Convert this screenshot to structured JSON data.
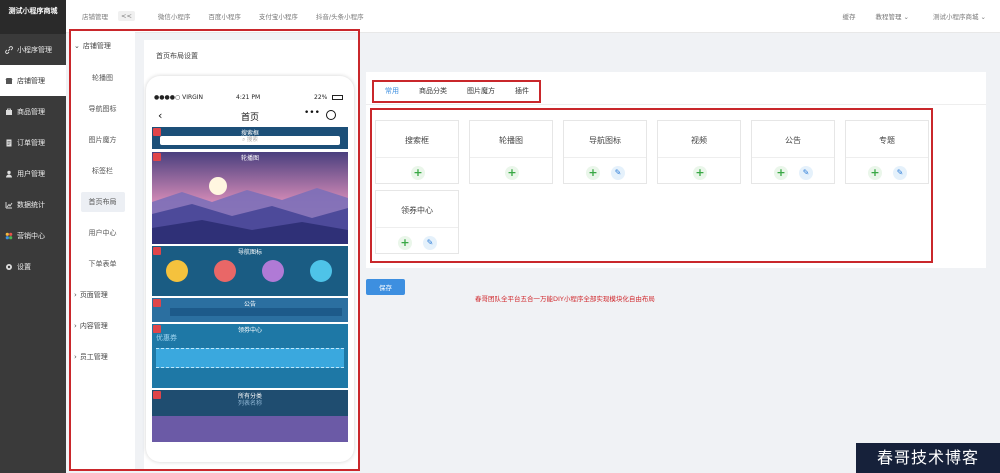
{
  "brand": {
    "title": "测试小程序商城"
  },
  "sidebar": {
    "items": [
      {
        "label": "小程序管理",
        "icon": "link-icon"
      },
      {
        "label": "店铺管理",
        "icon": "shop-icon"
      },
      {
        "label": "商品管理",
        "icon": "goods-icon"
      },
      {
        "label": "订单管理",
        "icon": "order-icon"
      },
      {
        "label": "用户管理",
        "icon": "user-icon"
      },
      {
        "label": "数据统计",
        "icon": "chart-icon"
      },
      {
        "label": "营销中心",
        "icon": "marketing-icon"
      },
      {
        "label": "设置",
        "icon": "settings-icon"
      }
    ]
  },
  "topbar": {
    "breadcrumb": "店铺管理",
    "collapse": "<<",
    "tabs": [
      "微信小程序",
      "百度小程序",
      "支付宝小程序",
      "抖音/头条小程序"
    ],
    "cache": "缓存",
    "tutorial": "教程管理",
    "shop": "测试小程序商城"
  },
  "subnav": {
    "group": "店铺管理",
    "items": [
      "轮播图",
      "导航图标",
      "图片魔方",
      "标签栏",
      "首页布局",
      "用户中心",
      "下单表单"
    ],
    "collapsed": [
      "页面管理",
      "内容管理",
      "员工管理"
    ]
  },
  "panel": {
    "title": "首页布局设置"
  },
  "phone": {
    "carrier": "●●●●○ VIRGIN",
    "time": "4:21 PM",
    "battery": "22%",
    "page_title": "首页",
    "blocks": {
      "search": "搜索框",
      "search_placeholder": "搜索",
      "banner": "轮播图",
      "nav": "导航图标",
      "notice": "公告",
      "coupon": "领券中心",
      "coupon_text": "优惠券",
      "category": "所有分类",
      "category_text": "列表名称"
    }
  },
  "tabs": [
    "常用",
    "商品分类",
    "图片魔方",
    "插件"
  ],
  "modules": [
    {
      "name": "搜索框",
      "edit": false
    },
    {
      "name": "轮播图",
      "edit": false
    },
    {
      "name": "导航图标",
      "edit": true
    },
    {
      "name": "视频",
      "edit": false
    },
    {
      "name": "公告",
      "edit": true
    },
    {
      "name": "专题",
      "edit": true
    },
    {
      "name": "领券中心",
      "edit": true
    }
  ],
  "save_label": "保存",
  "notice_text": "春哥团队全平台五合一万能DIY小程序全部实现模块化自由布局",
  "watermark": "春哥技术博客",
  "colors": {
    "accent": "#3d8fe0",
    "highlight": "#c9272b",
    "sidebar": "#3a3a3a"
  }
}
